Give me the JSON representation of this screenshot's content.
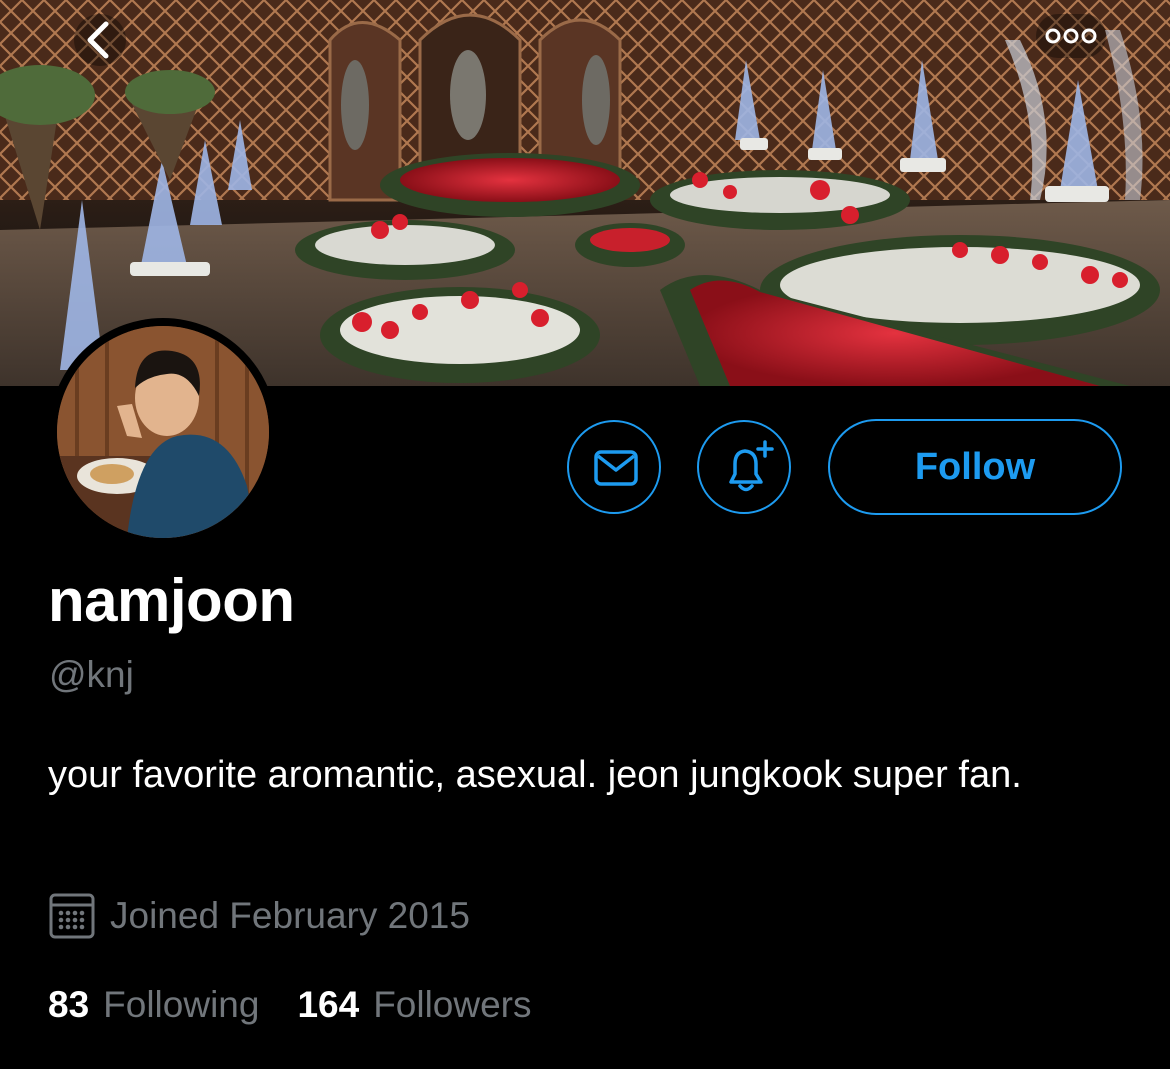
{
  "profile": {
    "display_name": "namjoon",
    "handle": "@knj",
    "bio": "your favorite aromantic, asexual. jeon jungkook super fan.",
    "joined": "Joined February 2015",
    "following_count": "83",
    "following_label": "Following",
    "followers_count": "164",
    "followers_label": "Followers"
  },
  "actions": {
    "follow_label": "Follow"
  },
  "icons": {
    "back": "chevron-left-icon",
    "more": "more-horizontal-icon",
    "message": "envelope-icon",
    "notifications": "bell-plus-icon",
    "calendar": "calendar-icon"
  },
  "colors": {
    "accent": "#1d9bf0",
    "background": "#000000",
    "secondary_text": "#71767b",
    "primary_text": "#ffffff"
  }
}
